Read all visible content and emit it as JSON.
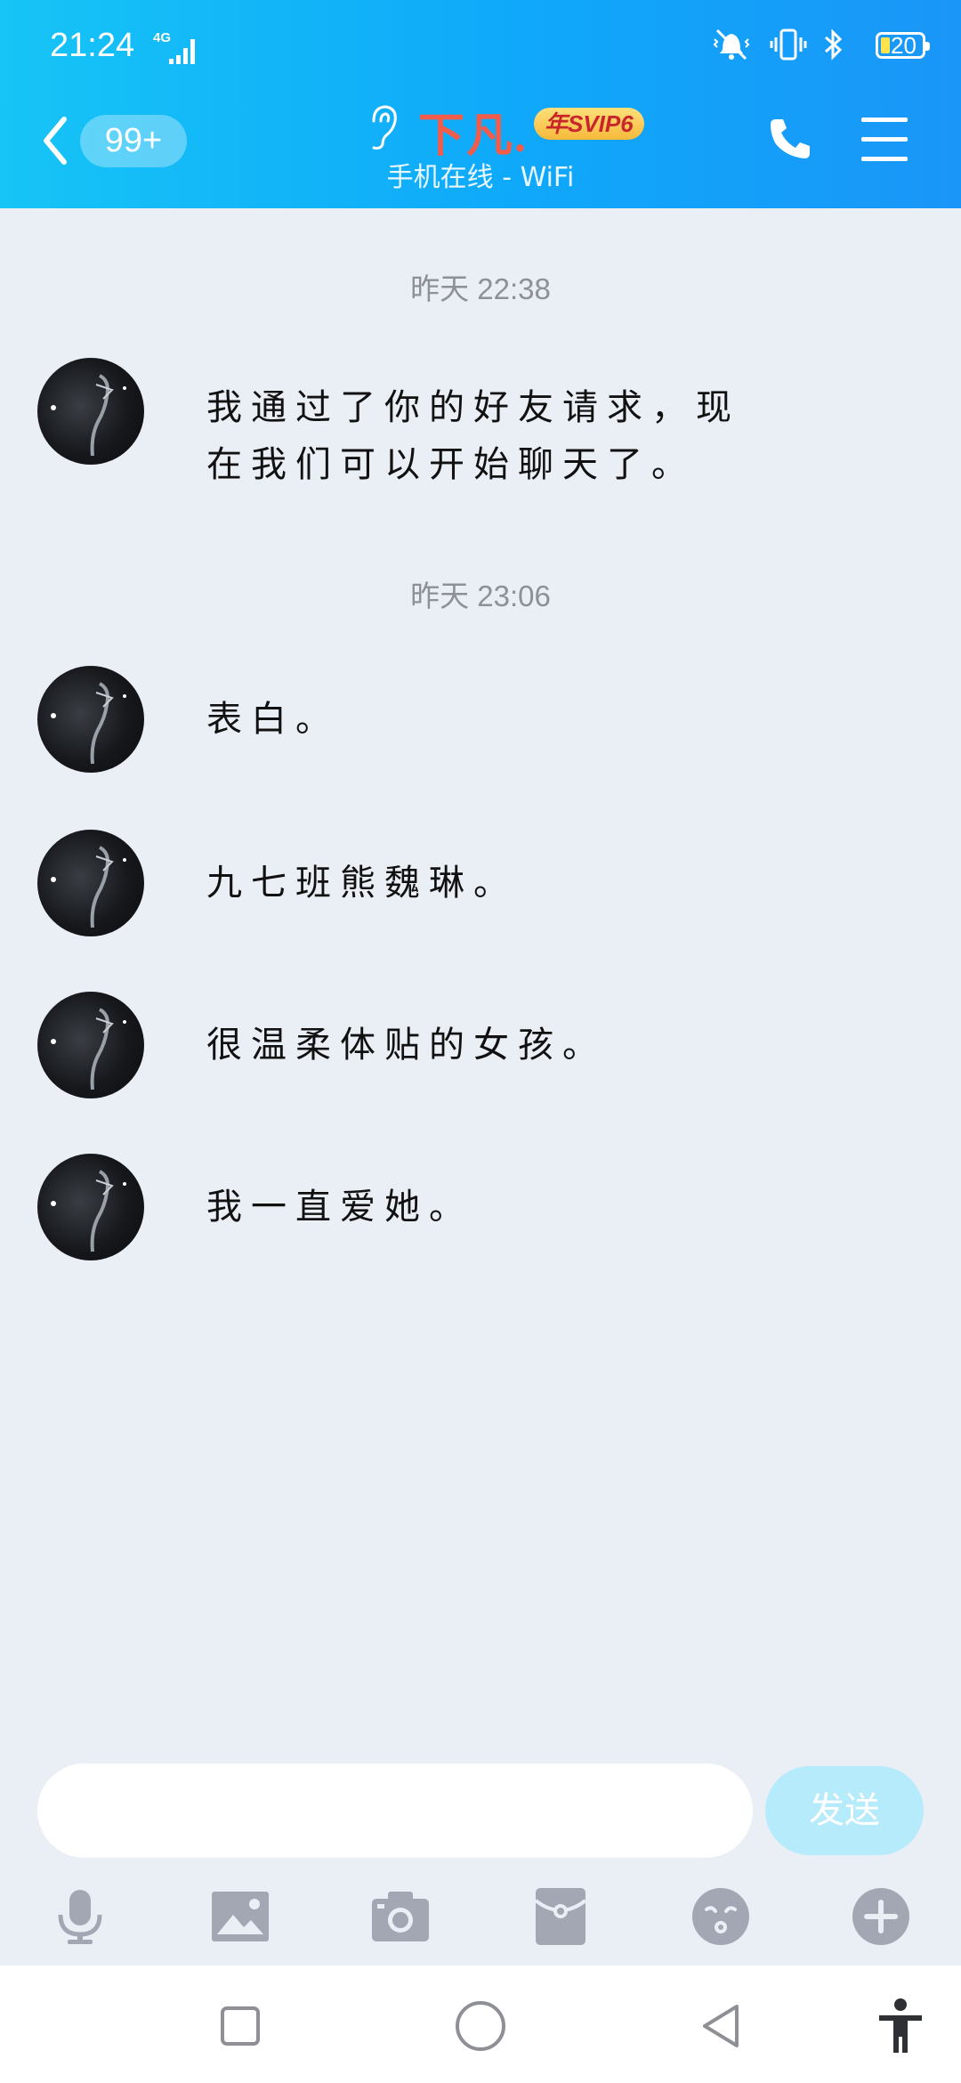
{
  "status_bar": {
    "time": "21:24",
    "network": "4G",
    "battery": "20"
  },
  "header": {
    "unread_count": "99+",
    "contact_name": "下凡.",
    "badge": "年SVIP6",
    "status": "手机在线 - WiFi"
  },
  "chat": {
    "groups": [
      {
        "timestamp": "昨天 22:38",
        "messages": [
          {
            "line1": "我通过了你的好友请求，现",
            "line2": "在我们可以开始聊天了。"
          }
        ]
      },
      {
        "timestamp": "昨天 23:06",
        "messages": [
          {
            "text": "表白。"
          },
          {
            "text": "九七班熊魏琳。"
          },
          {
            "text": "很温柔体贴的女孩。"
          },
          {
            "text": "我一直爱她。"
          }
        ]
      }
    ]
  },
  "input": {
    "placeholder": "",
    "send_label": "发送"
  },
  "toolbar": {
    "items": [
      "microphone-icon",
      "image-icon",
      "camera-icon",
      "red-packet-icon",
      "emoji-icon",
      "plus-icon"
    ]
  },
  "colors": {
    "header_start": "#16C4F6",
    "header_end": "#1A96F8",
    "background": "#EAEEF5",
    "name": "#F25C4B",
    "send_button": "#B6EBFB",
    "tool_icon": "#A2A7B3"
  }
}
